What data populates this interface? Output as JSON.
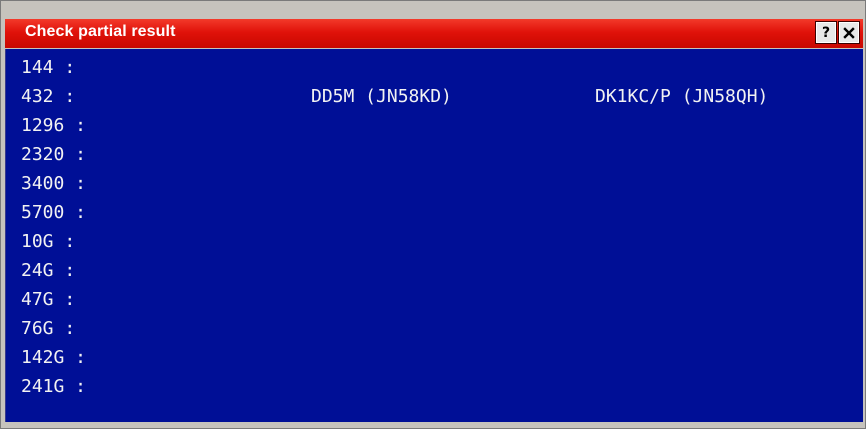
{
  "window": {
    "title": "Check partial result",
    "help_icon": "help-icon",
    "close_icon": "close-icon"
  },
  "colors": {
    "titlebar": "#e0120a",
    "content_bg": "#000f96",
    "text": "#f2f2f2"
  },
  "rows": [
    {
      "band": "144 :",
      "station1": "",
      "station2": ""
    },
    {
      "band": "432 :",
      "station1": "DD5M (JN58KD)",
      "station2": "DK1KC/P (JN58QH)"
    },
    {
      "band": "1296 :",
      "station1": "",
      "station2": ""
    },
    {
      "band": "2320 :",
      "station1": "",
      "station2": ""
    },
    {
      "band": "3400 :",
      "station1": "",
      "station2": ""
    },
    {
      "band": "5700 :",
      "station1": "",
      "station2": ""
    },
    {
      "band": "10G :",
      "station1": "",
      "station2": ""
    },
    {
      "band": "24G :",
      "station1": "",
      "station2": ""
    },
    {
      "band": "47G :",
      "station1": "",
      "station2": ""
    },
    {
      "band": "76G :",
      "station1": "",
      "station2": ""
    },
    {
      "band": "142G :",
      "station1": "",
      "station2": ""
    },
    {
      "band": "241G :",
      "station1": "",
      "station2": ""
    }
  ]
}
